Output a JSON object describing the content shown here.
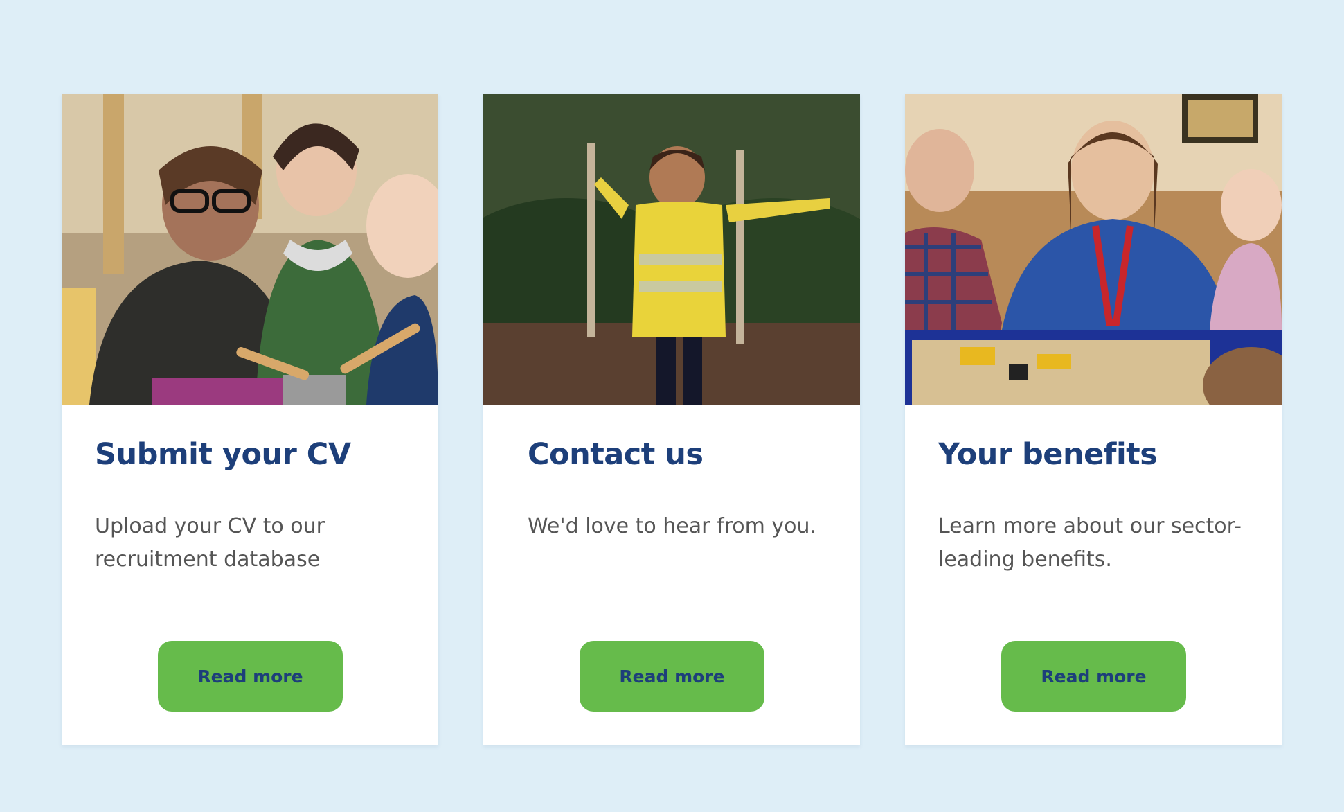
{
  "cards": [
    {
      "title": "Submit your CV",
      "description": "Upload your CV to our recruitment database",
      "button_label": "Read more",
      "image": "photo-adult-and-toddlers-playing-drums"
    },
    {
      "title": "Contact us",
      "description": "We'd love to hear from you.",
      "button_label": "Read more",
      "image": "photo-child-in-hi-vis-vest-outdoors"
    },
    {
      "title": "Your benefits",
      "description": "Learn more about our sector-leading benefits.",
      "button_label": "Read more",
      "image": "photo-teacher-and-children-at-sand-tray"
    }
  ],
  "colors": {
    "page_background": "#deeef7",
    "card_background": "#ffffff",
    "title": "#1d3f7a",
    "body_text": "#555555",
    "button": "#66bb4b",
    "button_text": "#1d3f7a"
  }
}
